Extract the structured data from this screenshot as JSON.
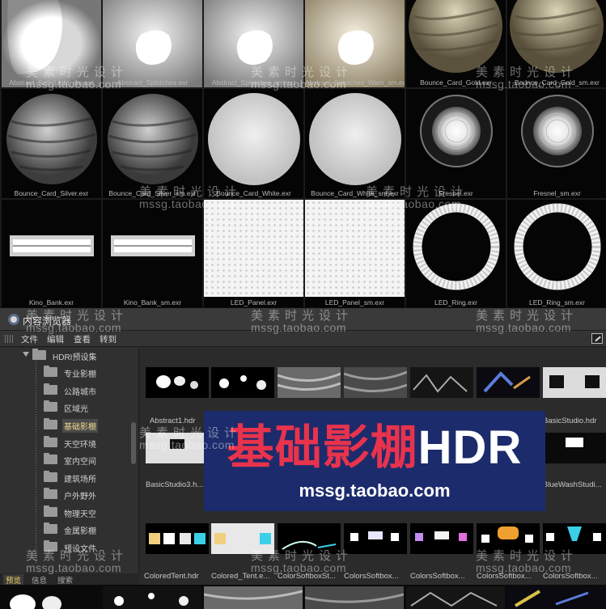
{
  "top_grid": {
    "items": [
      {
        "label": "Abstract_Soft_Light_sm.exr",
        "thumb": "blob-white"
      },
      {
        "label": "Abstract_Splotches.exr",
        "thumb": "splotch-grey"
      },
      {
        "label": "Abstract_Splotches_sm.exr",
        "thumb": "splotch-grey"
      },
      {
        "label": "Abstract_Splotches_Wam_sm.exr",
        "thumb": "splotch-warm"
      },
      {
        "label": "Bounce_Card_Gold.exr",
        "thumb": "sphere-gold"
      },
      {
        "label": "Bounce_Card_Gold_sm.exr",
        "thumb": "sphere-gold"
      },
      {
        "label": "Bounce_Card_Silver.exr",
        "thumb": "sphere-silver"
      },
      {
        "label": "Bounce_Card_Silver_sm.exr",
        "thumb": "sphere-silver"
      },
      {
        "label": "Bounce_Card_White.exr",
        "thumb": "sphere-white"
      },
      {
        "label": "Bounce_Card_White_sm.exr",
        "thumb": "sphere-white"
      },
      {
        "label": "Fresnel.exr",
        "thumb": "fresnel"
      },
      {
        "label": "Fresnel_sm.exr",
        "thumb": "fresnel"
      },
      {
        "label": "Kino_Bank.exr",
        "thumb": "kino"
      },
      {
        "label": "Kino_Bank_sm.exr",
        "thumb": "kino"
      },
      {
        "label": "LED_Panel.exr",
        "thumb": "led-panel"
      },
      {
        "label": "LED_Panel_sm.exr",
        "thumb": "led-panel"
      },
      {
        "label": "LED_Ring.exr",
        "thumb": "ring"
      },
      {
        "label": "LED_Ring_sm.exr",
        "thumb": "ring"
      }
    ]
  },
  "browser": {
    "title": "内容浏览器",
    "menu": [
      "文件",
      "编辑",
      "查看",
      "转到"
    ],
    "tree": {
      "root": "HDRI预设集",
      "items": [
        "专业影棚",
        "公路城市",
        "区域光",
        "基础影棚",
        "天空环境",
        "室内空间",
        "建筑场所",
        "户外野外",
        "物理天空",
        "金属影棚",
        "预设文件"
      ],
      "selected": "基础影棚"
    },
    "tabs": [
      "预览",
      "信息",
      "搜索"
    ],
    "active_tab": "预览",
    "content": {
      "row1_labels": [
        "Abstract1.hdr",
        "BasicStudio.hdr"
      ],
      "row2_labels": [
        "BasicStudio3.h...",
        "BlueWashStudi..."
      ],
      "row3_labels": [
        "ColoredTent.hdr",
        "Colored_Tent.e...",
        "ColorSoftboxSt...",
        "ColorsSoftbox...",
        "ColorsSoftbox...",
        "ColorsSoftbox...",
        "ColorsSoftbox..."
      ]
    }
  },
  "banner": {
    "title_cn": "基础影棚",
    "title_en": "HDR",
    "url": "mssg.taobao.com"
  },
  "watermark": {
    "cn": "美素时光设计",
    "url": "mssg.taobao.com"
  },
  "colors": {
    "banner_bg": "#1c2b6c",
    "banner_red": "#e8334c",
    "selection_text": "#f0d890"
  }
}
